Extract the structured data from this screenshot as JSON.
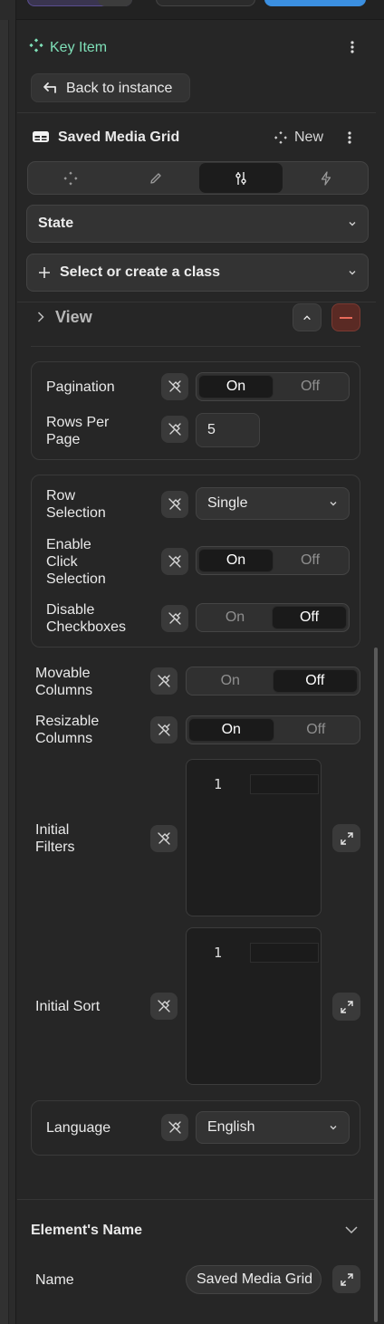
{
  "panel": {
    "key_item_label": "Key Item",
    "back_button_label": "Back to instance",
    "element_title": "Saved Media Grid",
    "new_label": "New",
    "tabs": [
      {
        "icon": "move-icon"
      },
      {
        "icon": "pencil-icon"
      },
      {
        "icon": "sliders-icon",
        "active": true
      },
      {
        "icon": "lightning-icon"
      }
    ],
    "state_label": "State",
    "class_select_label": "Select or create a class",
    "view_label": "View"
  },
  "pagination_group": {
    "pagination_label": "Pagination",
    "pagination_on": "On",
    "pagination_off": "Off",
    "rows_per_page_label_1": "Rows Per",
    "rows_per_page_label_2": "Page",
    "rows_per_page_value": "5"
  },
  "selection_group": {
    "row_selection_label_1": "Row",
    "row_selection_label_2": "Selection",
    "row_selection_value": "Single",
    "click_selection_label_1": "Enable",
    "click_selection_label_2": "Click",
    "click_selection_label_3": "Selection",
    "click_on": "On",
    "click_off": "Off",
    "disable_checkboxes_label_1": "Disable",
    "disable_checkboxes_label_2": "Checkboxes",
    "checkboxes_on": "On",
    "checkboxes_off": "Off"
  },
  "columns": {
    "movable_label_1": "Movable",
    "movable_label_2": "Columns",
    "movable_on": "On",
    "movable_off": "Off",
    "resizable_label_1": "Resizable",
    "resizable_label_2": "Columns",
    "resizable_on": "On",
    "resizable_off": "Off"
  },
  "filters": {
    "initial_filters_label_1": "Initial",
    "initial_filters_label_2": "Filters",
    "filters_line_number": "1",
    "initial_sort_label": "Initial Sort",
    "sort_line_number": "1"
  },
  "language": {
    "label": "Language",
    "value": "English"
  },
  "element_name": {
    "section_title": "Element's Name",
    "name_label": "Name",
    "name_value": "Saved Media Grid"
  },
  "colors": {
    "accent_green": "#7fe0b8",
    "remove_button": "#5a2a24",
    "top_blue": "#3b8fe0"
  }
}
